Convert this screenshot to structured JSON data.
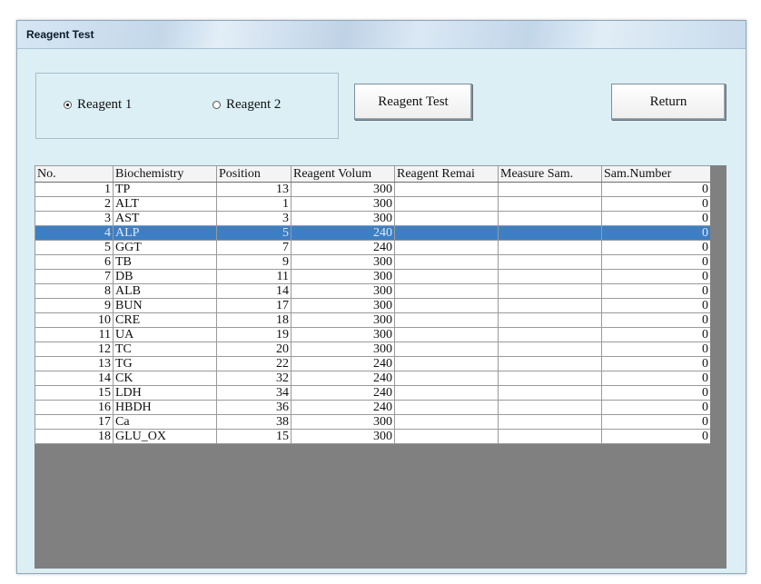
{
  "window": {
    "title": "Reagent Test"
  },
  "controls": {
    "radio1_label": "Reagent 1",
    "radio2_label": "Reagent 2",
    "selected_radio": "Reagent 1",
    "reagent_test_button": "Reagent Test",
    "return_button": "Return"
  },
  "table": {
    "columns": [
      "No.",
      "Biochemistry",
      "Position",
      "Reagent Volum",
      "Reagent Remai",
      "Measure Sam.",
      "Sam.Number"
    ],
    "rows": [
      {
        "no": "1",
        "biochemistry": "TP",
        "position": "13",
        "volume": "300",
        "remain": "",
        "measure": "",
        "sam_number": "0"
      },
      {
        "no": "2",
        "biochemistry": "ALT",
        "position": "1",
        "volume": "300",
        "remain": "",
        "measure": "",
        "sam_number": "0"
      },
      {
        "no": "3",
        "biochemistry": "AST",
        "position": "3",
        "volume": "300",
        "remain": "",
        "measure": "",
        "sam_number": "0"
      },
      {
        "no": "4",
        "biochemistry": "ALP",
        "position": "5",
        "volume": "240",
        "remain": "",
        "measure": "",
        "sam_number": "0"
      },
      {
        "no": "5",
        "biochemistry": "GGT",
        "position": "7",
        "volume": "240",
        "remain": "",
        "measure": "",
        "sam_number": "0"
      },
      {
        "no": "6",
        "biochemistry": "TB",
        "position": "9",
        "volume": "300",
        "remain": "",
        "measure": "",
        "sam_number": "0"
      },
      {
        "no": "7",
        "biochemistry": "DB",
        "position": "11",
        "volume": "300",
        "remain": "",
        "measure": "",
        "sam_number": "0"
      },
      {
        "no": "8",
        "biochemistry": "ALB",
        "position": "14",
        "volume": "300",
        "remain": "",
        "measure": "",
        "sam_number": "0"
      },
      {
        "no": "9",
        "biochemistry": "BUN",
        "position": "17",
        "volume": "300",
        "remain": "",
        "measure": "",
        "sam_number": "0"
      },
      {
        "no": "10",
        "biochemistry": "CRE",
        "position": "18",
        "volume": "300",
        "remain": "",
        "measure": "",
        "sam_number": "0"
      },
      {
        "no": "11",
        "biochemistry": "UA",
        "position": "19",
        "volume": "300",
        "remain": "",
        "measure": "",
        "sam_number": "0"
      },
      {
        "no": "12",
        "biochemistry": "TC",
        "position": "20",
        "volume": "300",
        "remain": "",
        "measure": "",
        "sam_number": "0"
      },
      {
        "no": "13",
        "biochemistry": "TG",
        "position": "22",
        "volume": "240",
        "remain": "",
        "measure": "",
        "sam_number": "0"
      },
      {
        "no": "14",
        "biochemistry": "CK",
        "position": "32",
        "volume": "240",
        "remain": "",
        "measure": "",
        "sam_number": "0"
      },
      {
        "no": "15",
        "biochemistry": "LDH",
        "position": "34",
        "volume": "240",
        "remain": "",
        "measure": "",
        "sam_number": "0"
      },
      {
        "no": "16",
        "biochemistry": "HBDH",
        "position": "36",
        "volume": "240",
        "remain": "",
        "measure": "",
        "sam_number": "0"
      },
      {
        "no": "17",
        "biochemistry": "Ca",
        "position": "38",
        "volume": "300",
        "remain": "",
        "measure": "",
        "sam_number": "0"
      },
      {
        "no": "18",
        "biochemistry": "GLU_OX",
        "position": "15",
        "volume": "300",
        "remain": "",
        "measure": "",
        "sam_number": "0"
      }
    ],
    "selected_row": "4"
  },
  "colors": {
    "selection": "#3d7fc4",
    "client_background": "#dbeff4",
    "empty_grid_area": "#808080"
  }
}
